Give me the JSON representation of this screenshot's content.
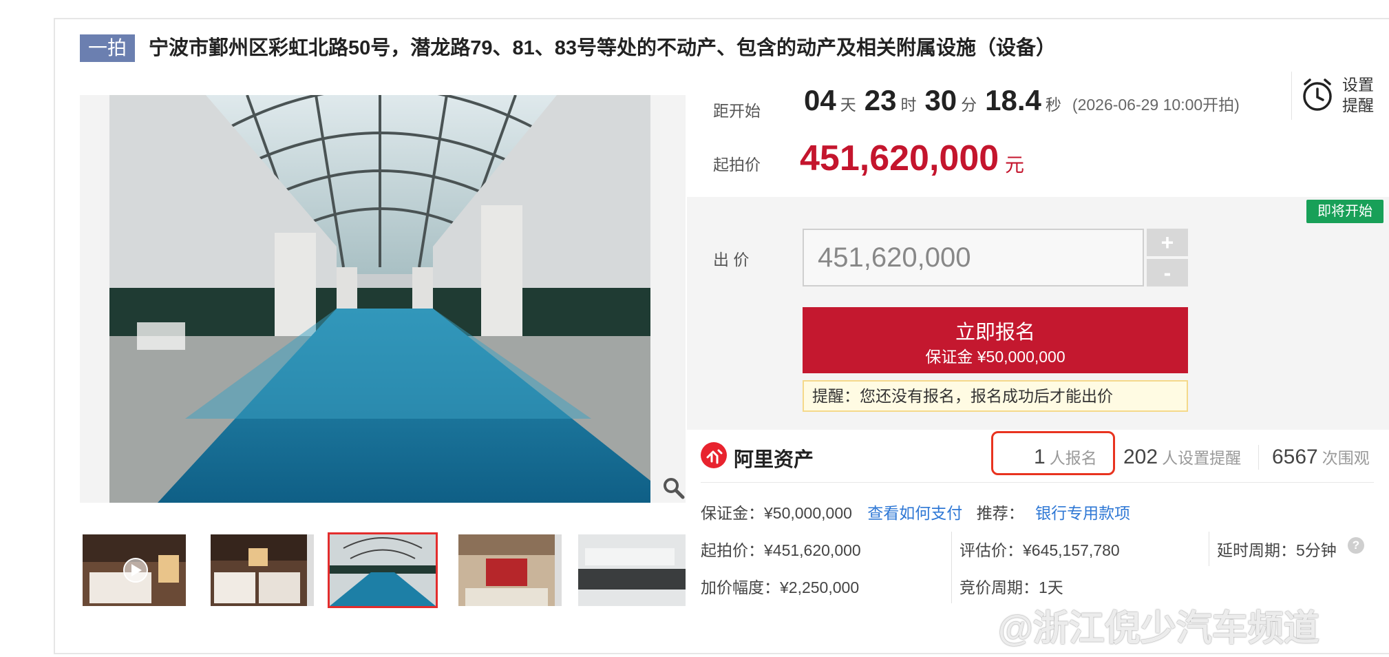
{
  "auction": {
    "tag": "一拍",
    "title": "宁波市鄞州区彩虹北路50号，潜龙路79、81、83号等处的不动产、包含的动产及相关附属设施（设备）"
  },
  "countdown": {
    "label": "距开始",
    "days": "04",
    "days_unit": "天",
    "hours": "23",
    "hours_unit": "时",
    "minutes": "30",
    "minutes_unit": "分",
    "seconds": "18.4",
    "seconds_unit": "秒",
    "start_time": "(2026-06-29 10:00开拍)"
  },
  "reminder": {
    "label": "设置提醒",
    "icon": "alarm-clock-icon"
  },
  "starting_price": {
    "label": "起拍价",
    "value": "451,620,000",
    "unit": "元"
  },
  "bid": {
    "badge": "即将开始",
    "label": "出 价",
    "input_value": "451,620,000",
    "plus": "+",
    "minus": "-",
    "signup_label": "立即报名",
    "signup_deposit": "保证金 ¥50,000,000",
    "notice": "提醒：您还没有报名，报名成功后才能出价"
  },
  "provider": {
    "name": "阿里资产"
  },
  "stats": {
    "registered_count": "1",
    "registered_label": "人报名",
    "reminder_count": "202",
    "reminder_label": "人设置提醒",
    "views_count": "6567",
    "views_label": "次围观"
  },
  "details": {
    "deposit": "保证金：¥50,000,000",
    "how_to_pay": "查看如何支付",
    "recommend_label": "推荐：",
    "recommend_link": "银行专用款项",
    "start_price": "起拍价：¥451,620,000",
    "appraisal": "评估价：¥645,157,780",
    "delay_period": "延时周期：5分钟",
    "increment": "加价幅度：¥2,250,000",
    "bidding_period": "竞价周期：1天",
    "help": "?"
  },
  "watermark": "@浙江倪少汽车频道",
  "colors": {
    "price_red": "#c4152d",
    "button_red": "#c4182f",
    "badge_green": "#18a058",
    "link_blue": "#2f78d5",
    "tag_blue": "#6b7fb0"
  }
}
